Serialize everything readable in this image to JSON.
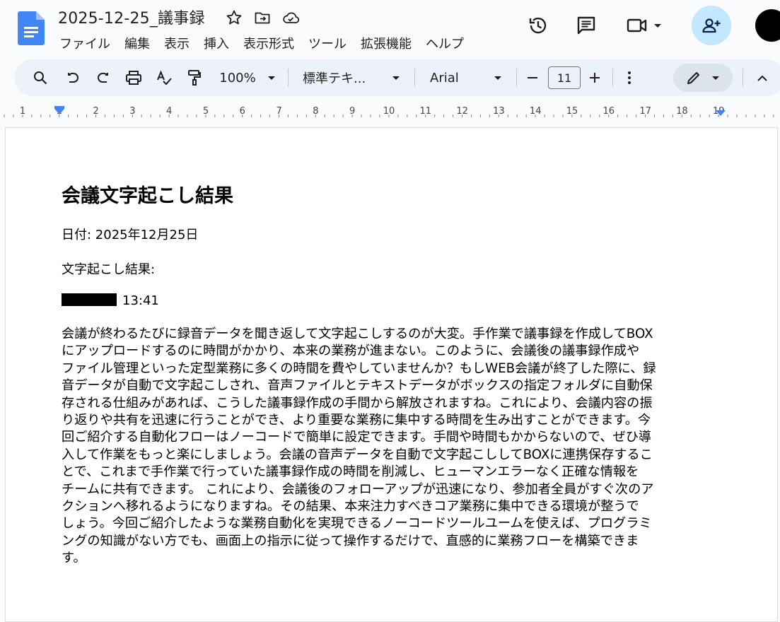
{
  "header": {
    "title": "2025-12-25_議事録",
    "menu": [
      "ファイル",
      "編集",
      "表示",
      "挿入",
      "表示形式",
      "ツール",
      "拡張機能",
      "ヘルプ"
    ]
  },
  "toolbar": {
    "zoom": "100%",
    "style": "標準テキ...",
    "font": "Arial",
    "font_size": "11"
  },
  "ruler": {
    "labels": [
      "1",
      "1",
      "2",
      "3",
      "4",
      "5",
      "6",
      "7",
      "8",
      "9",
      "10",
      "11",
      "12",
      "13",
      "14",
      "15",
      "16",
      "17",
      "18",
      "19"
    ]
  },
  "document": {
    "heading": "会議文字起こし結果",
    "date_line": "日付: 2025年12月25日",
    "transcript_label": "文字起こし結果:",
    "timestamp": "13:41",
    "paragraph_lines": [
      "会議が終わるたびに録音データを聞き返して文字起こしするのが大変。手作業で議事録を作成してBOX",
      "にアップロードするのに時間がかかり、本来の業務が進まない。このように、会議後の議事録作成や",
      "ファイル管理といった定型業務に多くの時間を費やしていませんか？もしWEB会議が終了した際に、録",
      "音データが自動で文字起こしされ、音声ファイルとテキストデータがボックスの指定フォルダに自動保",
      "存される仕組みがあれば、こうした議事録作成の手間から解放されますね。これにより、会議内容の振",
      "り返りや共有を迅速に行うことができ、より重要な業務に集中する時間を生み出すことができます。今",
      "回ご紹介する自動化フローはノーコードで簡単に設定できます。手間や時間もかからないので、ぜひ導",
      "入して作業をもっと楽にしましょう。会議の音声データを自動で文字起こししてBOXに連携保存するこ",
      "とで、これまで手作業で行っていた議事録作成の時間を削減し、ヒューマンエラーなく正確な情報を",
      "チームに共有できます。 これにより、会議後のフォローアップが迅速になり、参加者全員がすぐ次のア",
      "クションへ移れるようになりますね。その結果、本来注力すべきコア業務に集中できる環境が整うで",
      "しょう。今回ご紹介したような業務自動化を実現できるノーコードツールユームを使えば、プログラミ",
      "ングの知識がない方でも、画面上の指示に従って操作するだけで、直感的に業務フローを構築できま",
      "す。"
    ]
  },
  "colors": {
    "docs_blue": "#4285f4",
    "share_bg": "#c2e7ff",
    "toolbar_bg": "#edf2fa",
    "ruler_marker": "#4285f4"
  }
}
